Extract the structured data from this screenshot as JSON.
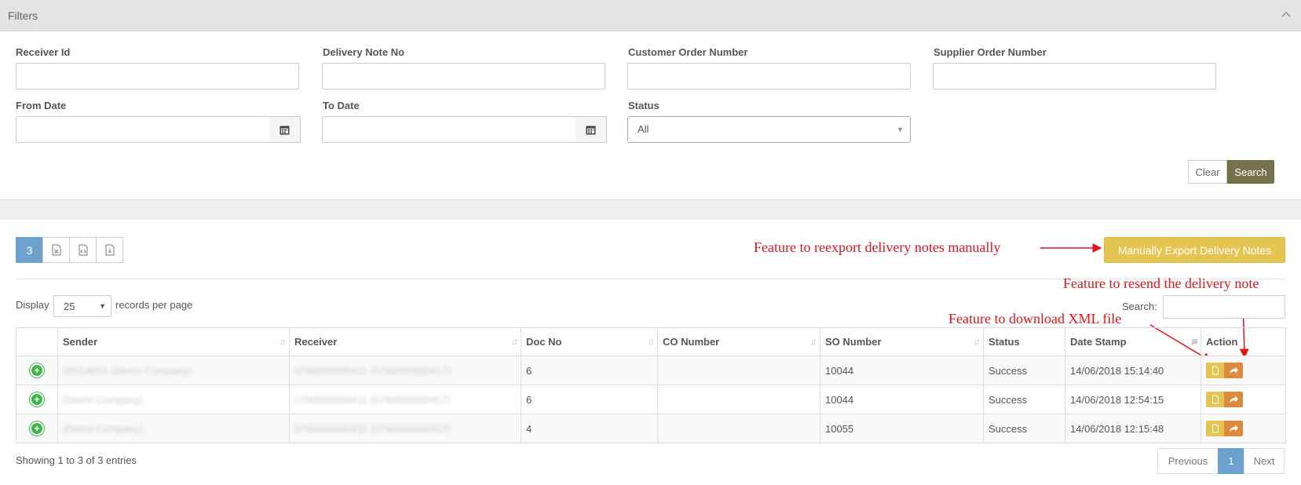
{
  "filters": {
    "title": "Filters",
    "receiver_id": {
      "label": "Receiver Id",
      "value": ""
    },
    "delivery_note_no": {
      "label": "Delivery Note No",
      "value": ""
    },
    "customer_order_number": {
      "label": "Customer Order Number",
      "value": ""
    },
    "supplier_order_number": {
      "label": "Supplier Order Number",
      "value": ""
    },
    "from_date": {
      "label": "From Date",
      "value": ""
    },
    "to_date": {
      "label": "To Date",
      "value": ""
    },
    "status": {
      "label": "Status",
      "selected": "All"
    },
    "clear_label": "Clear",
    "search_label": "Search"
  },
  "toolbar": {
    "count_button": "3",
    "manual_export_label": "Manually Export Delivery Notes"
  },
  "annotations": {
    "reexport": "Feature to reexport delivery notes manually",
    "resend": "Feature to resend the delivery note",
    "download_xml": "Feature to download XML file"
  },
  "table_controls": {
    "display_label": "Display",
    "page_length": "25",
    "records_per_page": "records per page",
    "search_label": "Search:",
    "search_value": ""
  },
  "table": {
    "columns": [
      "",
      "Sender",
      "Receiver",
      "Doc No",
      "CO Number",
      "SO Number",
      "Status",
      "Date Stamp",
      "Action"
    ],
    "rows": [
      {
        "sender": "00014001 (Demo Company)",
        "receiver": "0790000000411 (0790000000417)",
        "doc_no": "6",
        "co_number": "",
        "so_number": "10044",
        "status": "Success",
        "date_stamp": "14/06/2018 15:14:40"
      },
      {
        "sender": "(Demo Company)",
        "receiver": "0790000000411 (0790000000417)",
        "doc_no": "6",
        "co_number": "",
        "so_number": "10044",
        "status": "Success",
        "date_stamp": "14/06/2018 12:54:15"
      },
      {
        "sender": "(Demo Company)",
        "receiver": "0790000000411 (0790000000417)",
        "doc_no": "4",
        "co_number": "",
        "so_number": "10055",
        "status": "Success",
        "date_stamp": "14/06/2018 12:15:48"
      }
    ]
  },
  "footer": {
    "showing": "Showing 1 to 3 of 3 entries",
    "previous": "Previous",
    "page": "1",
    "next": "Next"
  },
  "colors": {
    "search_button": "#76734c",
    "manual_export": "#e4c551",
    "annotation_red": "#e0141a",
    "pager_active": "#6da2cf",
    "download_action": "#e4c551",
    "resend_action": "#dd8a3c"
  },
  "icons": {
    "collapse": "chevron-up-icon",
    "calendar": "calendar-icon",
    "excel": "excel-file-icon",
    "xml": "xml-file-icon",
    "pdf": "pdf-file-icon",
    "expand_row": "plus-circle-icon",
    "download": "download-xml-icon",
    "resend": "resend-icon"
  }
}
